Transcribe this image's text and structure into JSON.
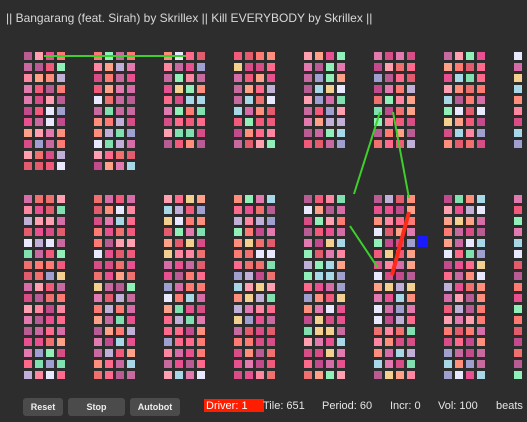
{
  "header": {
    "title": "|| Bangarang (feat. Sirah) by Skrillex || Kill EVERYBODY by Skrillex ||"
  },
  "controls": {
    "reset_label": "Reset",
    "stop_label": "Stop",
    "autobot_label": "Autobot"
  },
  "status": {
    "driver": "Driver: 1",
    "tile": "Tile: 651",
    "period": "Period: 60",
    "incr": "Incr: 0",
    "vol": "Vol: 100",
    "beats": "beats"
  },
  "colors": {
    "background": "#2d2d2d",
    "driver_highlight": "#ff1d00",
    "active_tile": "#1a1aff",
    "green_path": "#3fcf2c",
    "red_path": "#ff2a1a"
  },
  "grid": {
    "rows_per_block": 4,
    "cols_per_block": 4,
    "block_columns": 8,
    "block_rows": 2,
    "active_tile_label": "active-tile"
  }
}
